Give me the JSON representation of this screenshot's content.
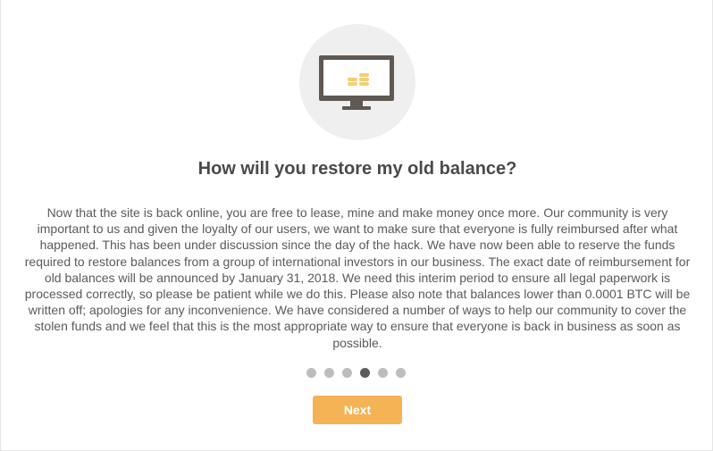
{
  "dialog": {
    "title": "How will you restore my old balance?",
    "body": "Now that the site is back online, you are free to lease, mine and make money once more. Our community is very important to us and given the loyalty of our users, we want to make sure that everyone is fully reimbursed after what happened. This has been under discussion since the day of the hack. We have now been able to reserve the funds required to restore balances from a group of international investors in our business. The exact date of reimbursement for old balances will be announced by January 31, 2018. We need this interim period to ensure all legal paperwork is processed correctly, so please be patient while we do this. Please also note that balances lower than 0.0001 BTC will be written off; apologies for any inconvenience. We have considered a number of ways to help our community to cover the stolen funds and we feel that this is the most appropriate way to ensure that everyone is back in business as soon as possible.",
    "illustration_icon": "monitor-with-coins-icon",
    "next_label": "Next"
  },
  "pagination": {
    "total": 6,
    "current": 4
  },
  "colors": {
    "accent": "#f4b354",
    "title": "#4a4a4a",
    "text": "#5a5a5a",
    "dot": "#bdbdbd",
    "dot_active": "#5c5c5c",
    "illustration_bg": "#f0efef",
    "monitor": "#5f5853",
    "coins": "#f6cf73"
  }
}
